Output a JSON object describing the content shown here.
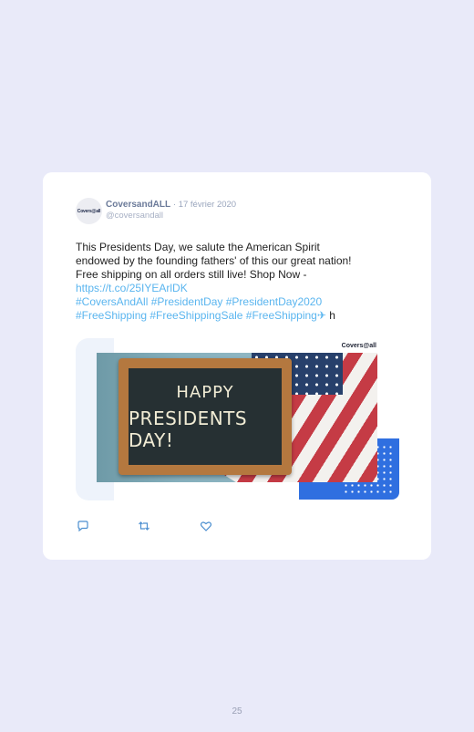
{
  "tweet": {
    "avatar_text": "Covers@all",
    "display_name": "CoversandALL",
    "date": "· 17 février 2020",
    "handle": "@coversandall",
    "text_line1": "This Presidents Day, we salute the American Spirit",
    "text_line2": "endowed by the founding fathers' of this our great nation!",
    "text_line3": "Free shipping on all orders still live! Shop Now -",
    "link": "https://t.co/25IYEArlDK",
    "hashtags1": "#CoversAndAll #PresidentDay #PresidentDay2020",
    "hashtags2": "#FreeShipping #FreeShippingSale #FreeShipping",
    "emoji": "✈",
    "trailing": " h"
  },
  "media": {
    "brand_label": "Covers@all",
    "chalk_line1": "HAPPY",
    "chalk_line2": "PRESIDENTS DAY!"
  },
  "icons": {
    "reply": "reply-icon",
    "retweet": "retweet-icon",
    "like": "like-icon"
  },
  "colors": {
    "link": "#5ab5ef",
    "accent_block": "#2f6fe0",
    "page_background": "#e9eaf9"
  },
  "page": {
    "number": "25"
  }
}
